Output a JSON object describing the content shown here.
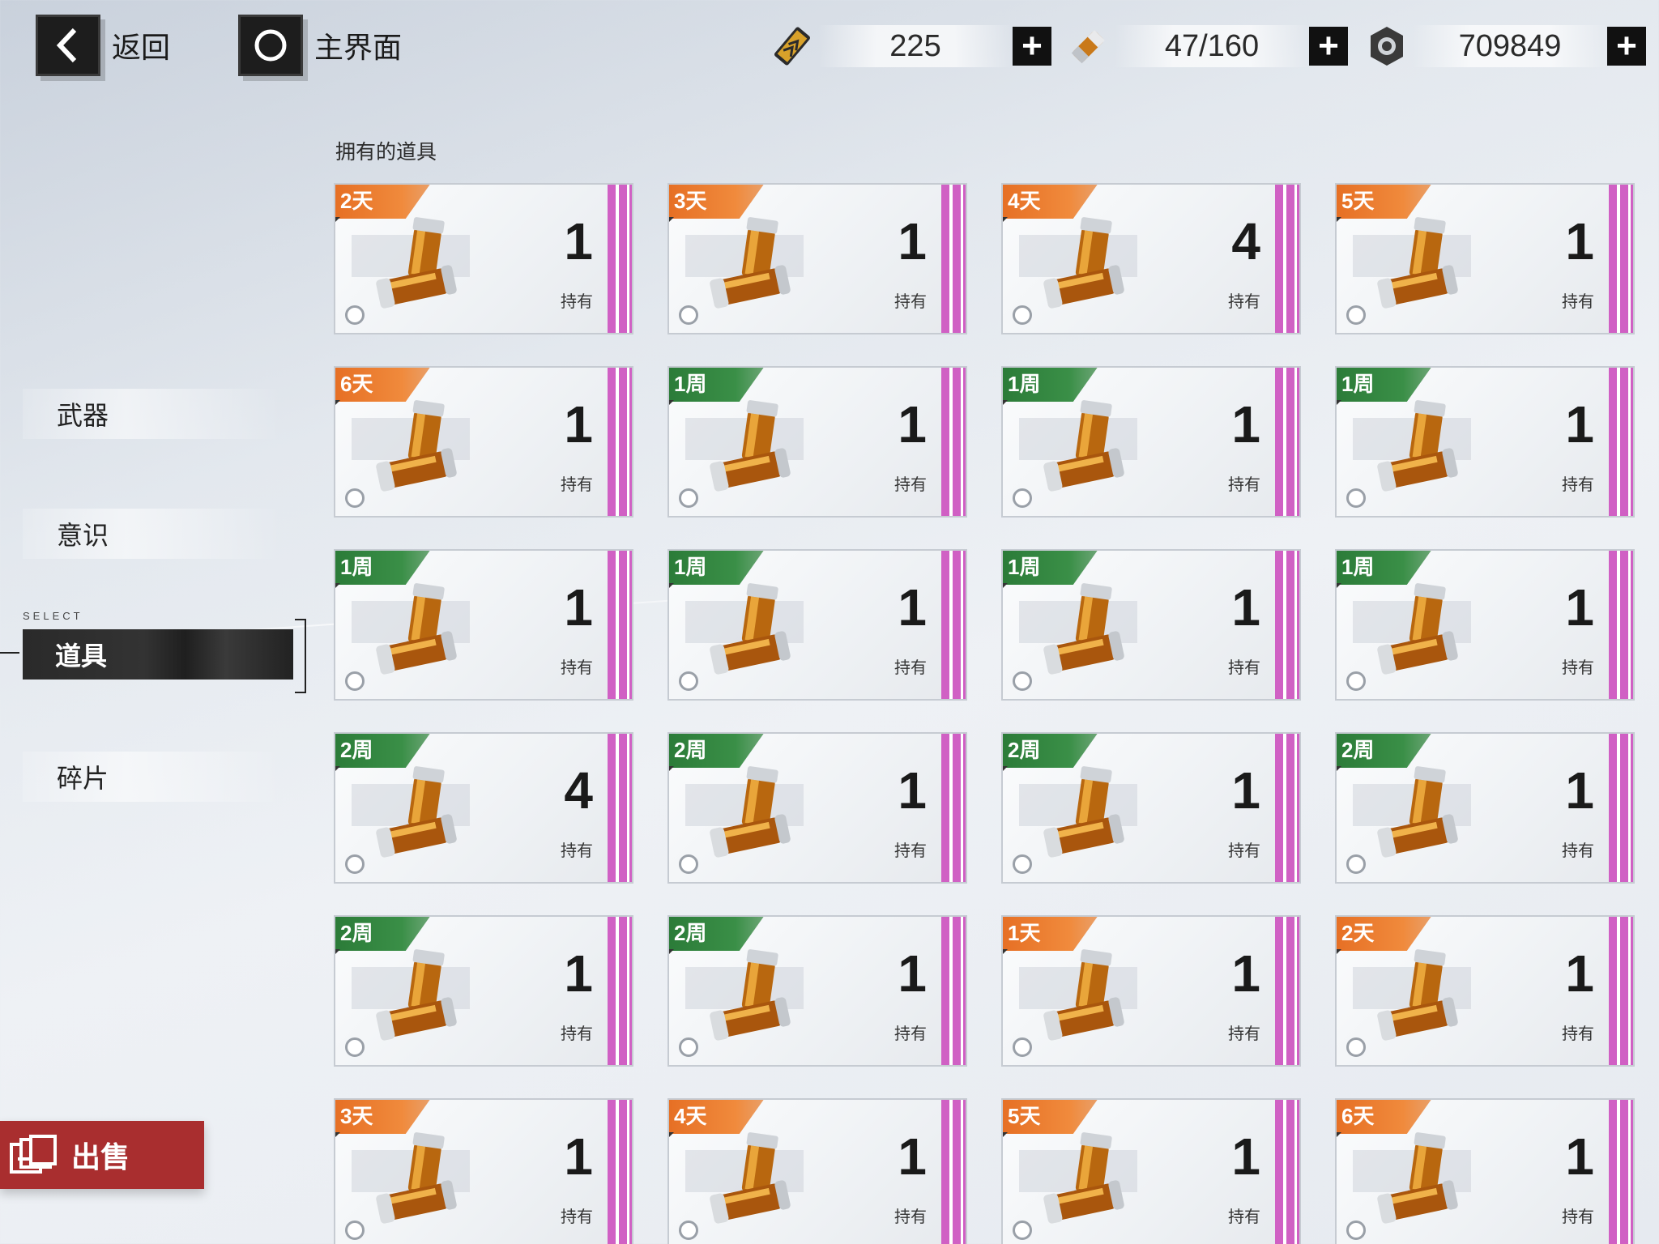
{
  "topbar": {
    "back_label": "返回",
    "home_label": "主界面",
    "resources": [
      {
        "icon": "ticket-icon",
        "value": "225"
      },
      {
        "icon": "stamina-icon",
        "value": "47/160"
      },
      {
        "icon": "coin-icon",
        "value": "709849"
      }
    ]
  },
  "sidebar": {
    "items": [
      "武器",
      "意识",
      "道具",
      "碎片"
    ],
    "selected_tag": "SELECT"
  },
  "sell_label": "出售",
  "section_title": "拥有的道具",
  "hold_label": "持有",
  "colors": {
    "orange_tag": "#e66f24",
    "green_tag": "#2b7b38",
    "rarity_stripe": "#d060c4",
    "sell_red": "#a92e2f"
  },
  "items": [
    {
      "tag": "2天",
      "tag_color": "orange",
      "count": "1"
    },
    {
      "tag": "3天",
      "tag_color": "orange",
      "count": "1"
    },
    {
      "tag": "4天",
      "tag_color": "orange",
      "count": "4"
    },
    {
      "tag": "5天",
      "tag_color": "orange",
      "count": "1"
    },
    {
      "tag": "6天",
      "tag_color": "orange",
      "count": "1"
    },
    {
      "tag": "1周",
      "tag_color": "green",
      "count": "1"
    },
    {
      "tag": "1周",
      "tag_color": "green",
      "count": "1"
    },
    {
      "tag": "1周",
      "tag_color": "green",
      "count": "1"
    },
    {
      "tag": "1周",
      "tag_color": "green",
      "count": "1"
    },
    {
      "tag": "1周",
      "tag_color": "green",
      "count": "1"
    },
    {
      "tag": "1周",
      "tag_color": "green",
      "count": "1"
    },
    {
      "tag": "1周",
      "tag_color": "green",
      "count": "1"
    },
    {
      "tag": "2周",
      "tag_color": "green",
      "count": "4"
    },
    {
      "tag": "2周",
      "tag_color": "green",
      "count": "1"
    },
    {
      "tag": "2周",
      "tag_color": "green",
      "count": "1"
    },
    {
      "tag": "2周",
      "tag_color": "green",
      "count": "1"
    },
    {
      "tag": "2周",
      "tag_color": "green",
      "count": "1"
    },
    {
      "tag": "2周",
      "tag_color": "green",
      "count": "1"
    },
    {
      "tag": "1天",
      "tag_color": "orange",
      "count": "1"
    },
    {
      "tag": "2天",
      "tag_color": "orange",
      "count": "1"
    },
    {
      "tag": "3天",
      "tag_color": "orange",
      "count": "1"
    },
    {
      "tag": "4天",
      "tag_color": "orange",
      "count": "1"
    },
    {
      "tag": "5天",
      "tag_color": "orange",
      "count": "1"
    },
    {
      "tag": "6天",
      "tag_color": "orange",
      "count": "1"
    }
  ]
}
